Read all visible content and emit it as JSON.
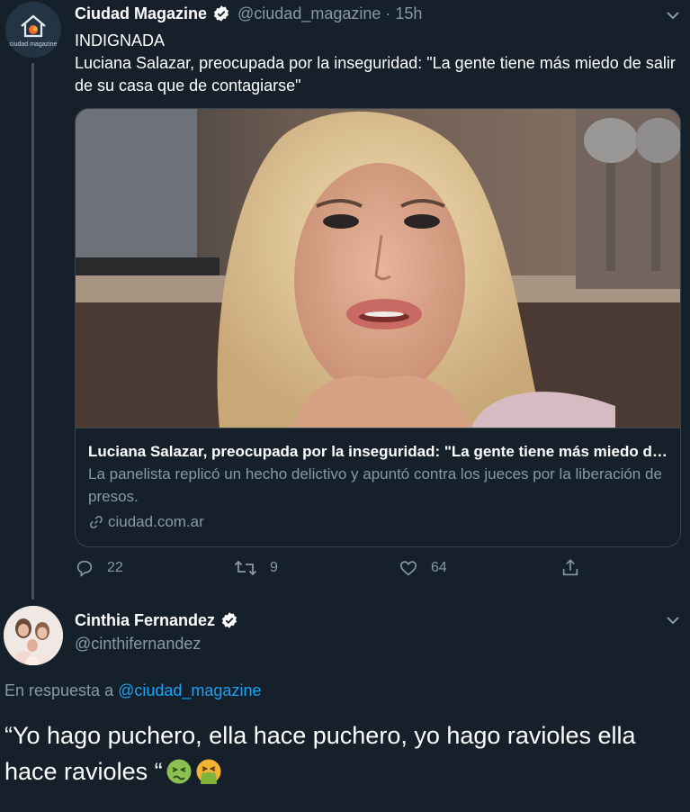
{
  "tweet1": {
    "avatar_text": "ciudad magazine",
    "name": "Ciudad Magazine",
    "handle": "@ciudad_magazine",
    "separator": "·",
    "time": "15h",
    "line1": "INDIGNADA",
    "line2": "Luciana Salazar, preocupada por la inseguridad: \"La gente tiene más miedo de salir de su casa que de contagiarse\"",
    "card": {
      "title": "Luciana Salazar, preocupada por la inseguridad: \"La gente tiene más miedo de salir de su casa que de contagiarse\"",
      "description": "La panelista replicó un hecho delictivo y apuntó contra los jueces por la liberación de presos.",
      "domain": "ciudad.com.ar"
    },
    "actions": {
      "replies": "22",
      "retweets": "9",
      "likes": "64"
    }
  },
  "tweet2": {
    "name": "Cinthia Fernandez",
    "handle": "@cinthifernandez",
    "reply_prefix": "En respuesta a",
    "reply_mention": "@ciudad_magazine",
    "text": "“Yo hago puchero, ella hace puchero, yo hago ravioles ella hace ravioles “",
    "emojis": [
      "nauseated-face",
      "vomiting-face"
    ]
  },
  "colors": {
    "background": "#15202b",
    "text": "#ffffff",
    "secondary": "#8899a6",
    "accent": "#1da1f2",
    "border": "#38444d"
  }
}
